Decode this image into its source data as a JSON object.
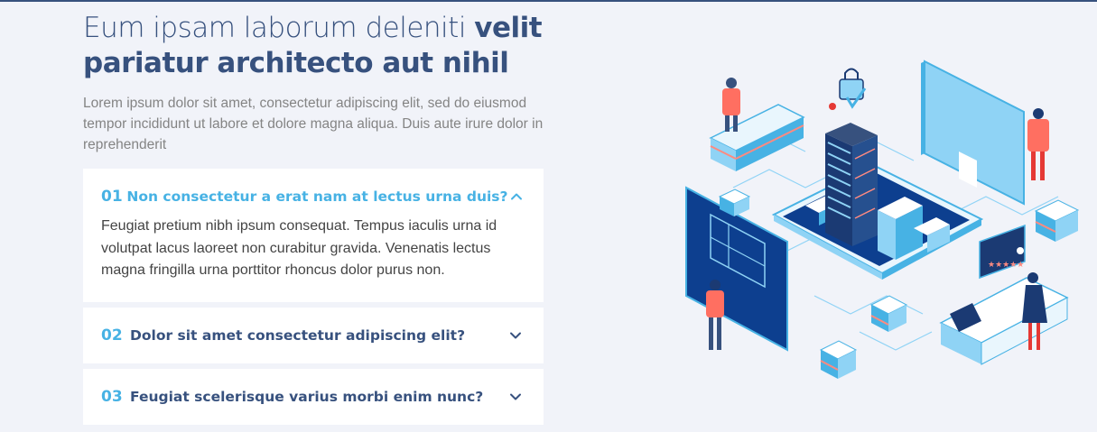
{
  "headline": {
    "light": "Eum ipsam laborum deleniti ",
    "strong": "velit pariatur architecto aut nihil"
  },
  "lead": "Lorem ipsum dolor sit amet, consectetur adipiscing elit, sed do eiusmod tempor incididunt ut labore et dolore magna aliqua. Duis aute irure dolor in reprehenderit",
  "faq": [
    {
      "num": "01",
      "question": "Non consectetur a erat nam at lectus urna duis?",
      "answer": "Feugiat pretium nibh ipsum consequat. Tempus iaculis urna id volutpat lacus laoreet non curabitur gravida. Venenatis lectus magna fringilla urna porttitor rhoncus dolor purus non.",
      "open": true
    },
    {
      "num": "02",
      "question": "Dolor sit amet consectetur adipiscing elit?",
      "open": false
    },
    {
      "num": "03",
      "question": "Feugiat scelerisque varius morbi enim nunc?",
      "open": false
    }
  ],
  "colors": {
    "primary": "#37517e",
    "accent": "#47b2e4",
    "background": "#f1f3f9"
  },
  "icons": {
    "open": "chevron-up-icon",
    "closed": "chevron-down-icon"
  }
}
